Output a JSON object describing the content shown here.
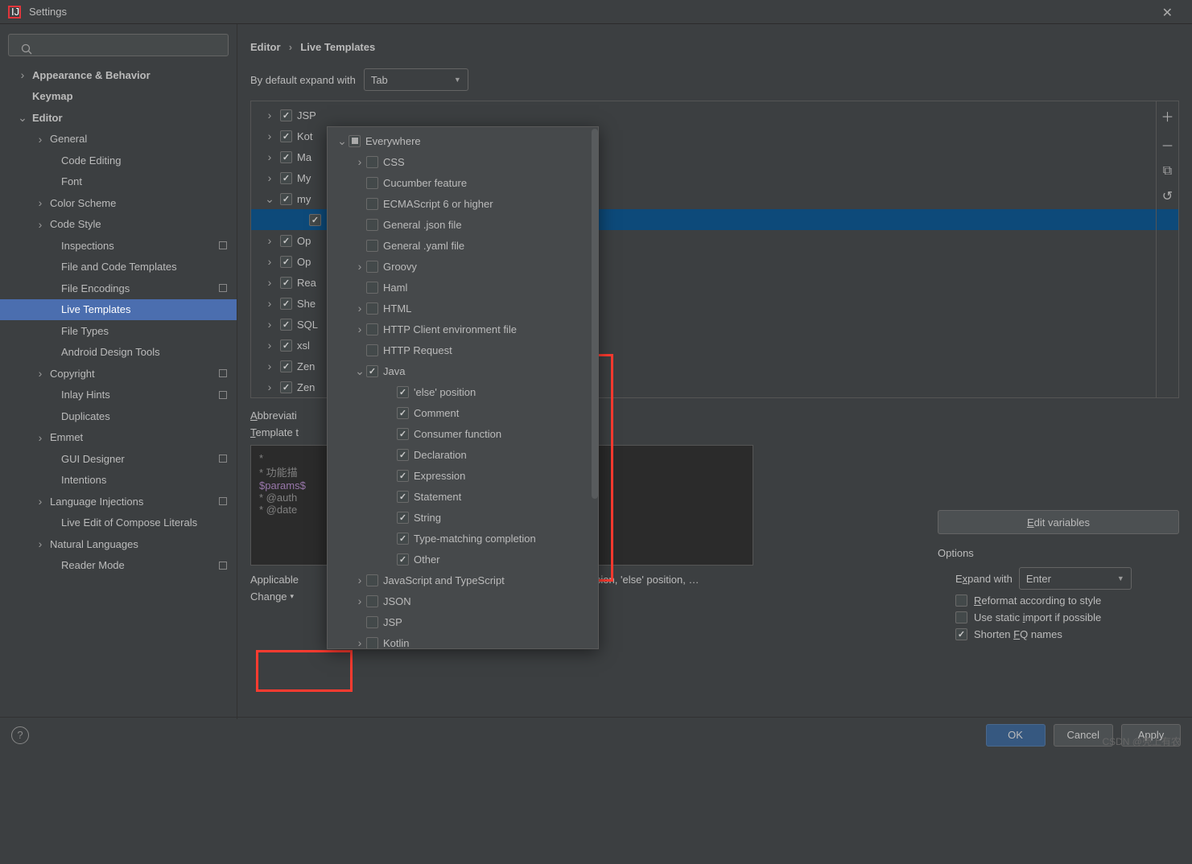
{
  "window": {
    "title": "Settings"
  },
  "breadcrumb": {
    "a": "Editor",
    "b": "Live Templates"
  },
  "expand": {
    "label": "By default expand with",
    "value": "Tab"
  },
  "sidebar": {
    "items": [
      {
        "label": "Appearance & Behavior",
        "lvl": 1,
        "chev": ">",
        "bold": true
      },
      {
        "label": "Keymap",
        "lvl": 1,
        "chev": "",
        "bold": true
      },
      {
        "label": "Editor",
        "lvl": 1,
        "chev": "v",
        "bold": true
      },
      {
        "label": "General",
        "lvl": 2,
        "chev": ">"
      },
      {
        "label": "Code Editing",
        "lvl": 3,
        "chev": ""
      },
      {
        "label": "Font",
        "lvl": 3,
        "chev": ""
      },
      {
        "label": "Color Scheme",
        "lvl": 2,
        "chev": ">"
      },
      {
        "label": "Code Style",
        "lvl": 2,
        "chev": ">"
      },
      {
        "label": "Inspections",
        "lvl": 3,
        "chev": "",
        "badge": true
      },
      {
        "label": "File and Code Templates",
        "lvl": 3,
        "chev": ""
      },
      {
        "label": "File Encodings",
        "lvl": 3,
        "chev": "",
        "badge": true
      },
      {
        "label": "Live Templates",
        "lvl": 3,
        "chev": "",
        "selected": true
      },
      {
        "label": "File Types",
        "lvl": 3,
        "chev": ""
      },
      {
        "label": "Android Design Tools",
        "lvl": 3,
        "chev": ""
      },
      {
        "label": "Copyright",
        "lvl": 2,
        "chev": ">",
        "badge": true
      },
      {
        "label": "Inlay Hints",
        "lvl": 3,
        "chev": "",
        "badge": true
      },
      {
        "label": "Duplicates",
        "lvl": 3,
        "chev": ""
      },
      {
        "label": "Emmet",
        "lvl": 2,
        "chev": ">"
      },
      {
        "label": "GUI Designer",
        "lvl": 3,
        "chev": "",
        "badge": true
      },
      {
        "label": "Intentions",
        "lvl": 3,
        "chev": ""
      },
      {
        "label": "Language Injections",
        "lvl": 2,
        "chev": ">",
        "badge": true
      },
      {
        "label": "Live Edit of Compose Literals",
        "lvl": 3,
        "chev": ""
      },
      {
        "label": "Natural Languages",
        "lvl": 2,
        "chev": ">"
      },
      {
        "label": "Reader Mode",
        "lvl": 3,
        "chev": "",
        "badge": true
      }
    ]
  },
  "templates": [
    {
      "label": "JSP",
      "chev": ">",
      "checked": true
    },
    {
      "label": "Kot",
      "chev": ">",
      "checked": true
    },
    {
      "label": "Ma",
      "chev": ">",
      "checked": true
    },
    {
      "label": "My",
      "chev": ">",
      "checked": true
    },
    {
      "label": "my",
      "chev": "v",
      "checked": true
    },
    {
      "label": "",
      "chev": "",
      "checked": true,
      "indent": true,
      "sel": true
    },
    {
      "label": "Op",
      "chev": ">",
      "checked": true
    },
    {
      "label": "Op",
      "chev": ">",
      "checked": true
    },
    {
      "label": "Rea",
      "chev": ">",
      "checked": true
    },
    {
      "label": "She",
      "chev": ">",
      "checked": true
    },
    {
      "label": "SQL",
      "chev": ">",
      "checked": true
    },
    {
      "label": "xsl",
      "chev": ">",
      "checked": true
    },
    {
      "label": "Zen",
      "chev": ">",
      "checked": true
    },
    {
      "label": "Zen",
      "chev": ">",
      "checked": true
    }
  ],
  "fields": {
    "abbrev_label": "Abbreviati",
    "template_label": "Template t",
    "code_l1": "*",
    "code_l2": " * 功能描",
    "code_l3": "$params$",
    "code_l4": " * @auth",
    "code_l5": " * @date"
  },
  "applicable": {
    "text": "Applicable",
    "truncated": "pression, 'else' position, …",
    "change": "Change"
  },
  "editvars": {
    "label": "Edit variables"
  },
  "options": {
    "title": "Options",
    "expand_label": "Expand with",
    "expand_value": "Enter",
    "reformat": "Reformat according to style",
    "static_import": "Use static import if possible",
    "shorten": "Shorten FQ names"
  },
  "popup": {
    "root": "Everywhere",
    "items": [
      {
        "label": "CSS",
        "chev": ">",
        "lvl": "B"
      },
      {
        "label": "Cucumber feature",
        "chev": "",
        "lvl": "B",
        "nochev": true
      },
      {
        "label": "ECMAScript 6 or higher",
        "chev": "",
        "lvl": "B",
        "nochev": true
      },
      {
        "label": "General .json file",
        "chev": "",
        "lvl": "B",
        "nochev": true
      },
      {
        "label": "General .yaml file",
        "chev": "",
        "lvl": "B",
        "nochev": true
      },
      {
        "label": "Groovy",
        "chev": ">",
        "lvl": "B"
      },
      {
        "label": "Haml",
        "chev": "",
        "lvl": "B",
        "nochev": true
      },
      {
        "label": "HTML",
        "chev": ">",
        "lvl": "B"
      },
      {
        "label": "HTTP Client environment file",
        "chev": ">",
        "lvl": "B"
      },
      {
        "label": "HTTP Request",
        "chev": "",
        "lvl": "B",
        "nochev": true
      },
      {
        "label": "Java",
        "chev": "v",
        "lvl": "B",
        "checked": true
      },
      {
        "label": "'else' position",
        "lvl": "C",
        "checked": true
      },
      {
        "label": "Comment",
        "lvl": "C",
        "checked": true
      },
      {
        "label": "Consumer function",
        "lvl": "C",
        "checked": true
      },
      {
        "label": "Declaration",
        "lvl": "C",
        "checked": true
      },
      {
        "label": "Expression",
        "lvl": "C",
        "checked": true
      },
      {
        "label": "Statement",
        "lvl": "C",
        "checked": true
      },
      {
        "label": "String",
        "lvl": "C",
        "checked": true
      },
      {
        "label": "Type-matching completion",
        "lvl": "C",
        "checked": true
      },
      {
        "label": "Other",
        "lvl": "C",
        "checked": true
      },
      {
        "label": "JavaScript and TypeScript",
        "chev": ">",
        "lvl": "B"
      },
      {
        "label": "JSON",
        "chev": ">",
        "lvl": "B"
      },
      {
        "label": "JSP",
        "chev": "",
        "lvl": "B",
        "nochev": true
      },
      {
        "label": "Kotlin",
        "chev": ">",
        "lvl": "B"
      }
    ]
  },
  "buttons": {
    "ok": "OK",
    "cancel": "Cancel",
    "apply": "Apply"
  },
  "watermark": "CSDN @壳上有农"
}
